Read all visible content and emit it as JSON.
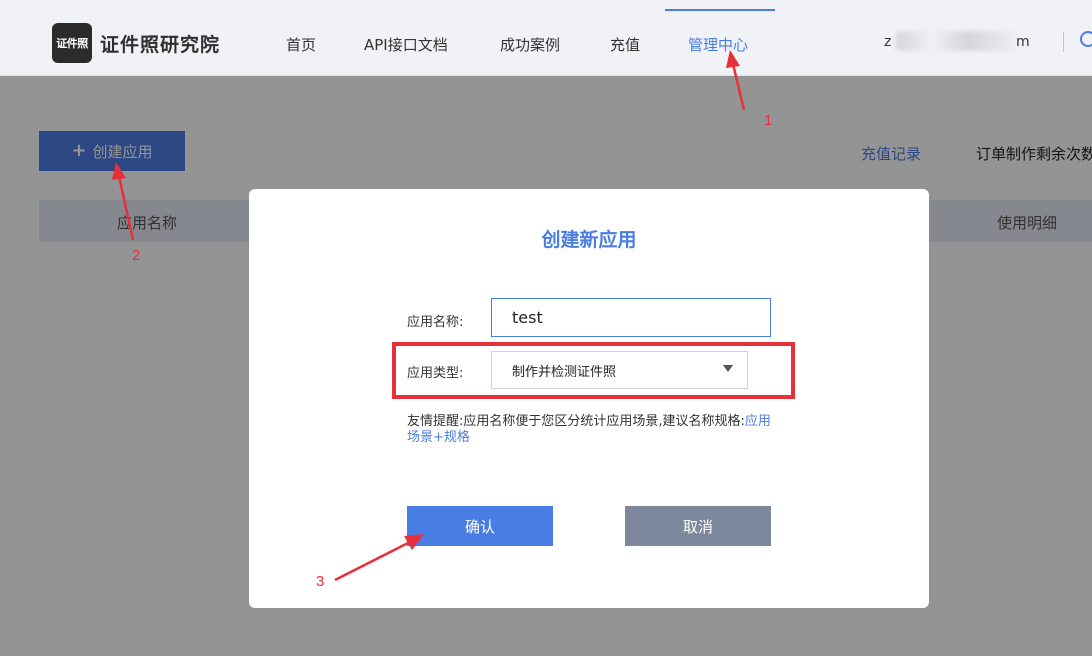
{
  "header": {
    "logo_badge": "证件照",
    "logo_text": "证件照研究院",
    "nav": [
      "首页",
      "API接口文档",
      "成功案例",
      "充值",
      "管理中心"
    ],
    "active_nav": "管理中心",
    "user_prefix": "z",
    "user_suffix": "m"
  },
  "page": {
    "create_button": "创建应用",
    "recharge_link": "充值记录",
    "remaining_text": "订单制作剩余次数",
    "table_headers": [
      "应用名称",
      "使用明细"
    ]
  },
  "modal": {
    "title": "创建新应用",
    "name_label": "应用名称:",
    "name_value": "test",
    "type_label": "应用类型:",
    "type_value": "制作并检测证件照",
    "hint_prefix": "友情提醒:应用名称便于您区分统计应用场景,建议名称规格:",
    "hint_link": "应用场景+规格",
    "confirm": "确认",
    "cancel": "取消"
  },
  "annotations": {
    "color": "#e8303a",
    "step1": "1",
    "step2": "2",
    "step3": "3"
  },
  "colors": {
    "accent": "#4a7de3",
    "cancel": "#7e889d"
  }
}
